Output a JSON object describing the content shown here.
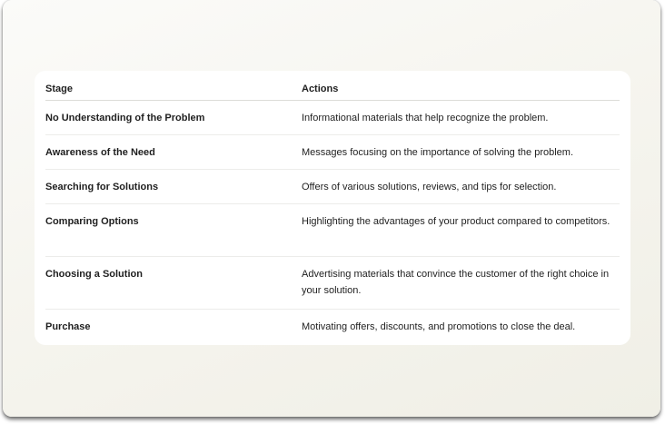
{
  "table": {
    "headers": {
      "stage": "Stage",
      "actions": "Actions"
    },
    "rows": [
      {
        "stage": "No Understanding of the Problem",
        "actions": "Informational materials that help recognize the problem."
      },
      {
        "stage": "Awareness of the Need",
        "actions": "Messages focusing on the importance of solving the problem."
      },
      {
        "stage": "Searching for Solutions",
        "actions": "Offers of various solutions, reviews, and tips for selection."
      },
      {
        "stage": "Comparing Options",
        "actions": "Highlighting the advantages of your product compared to competitors."
      },
      {
        "stage": "Choosing a Solution",
        "actions": "Advertising materials that convince the customer of the right choice in your solution."
      },
      {
        "stage": "Purchase",
        "actions": "Motivating offers, discounts, and promotions to close the deal."
      }
    ]
  }
}
